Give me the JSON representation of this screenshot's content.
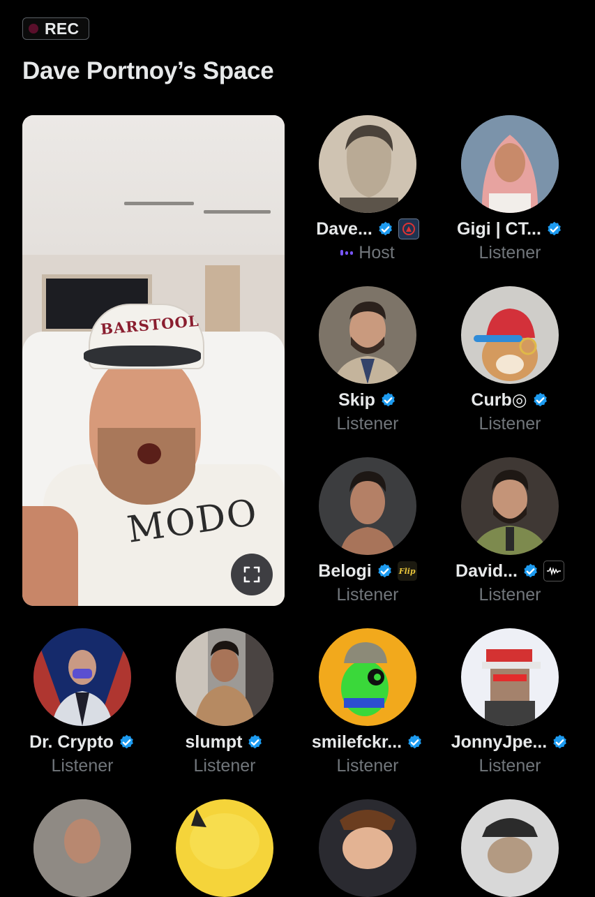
{
  "recording": {
    "label": "REC"
  },
  "space": {
    "title": "Dave Portnoy’s Space"
  },
  "video": {
    "cap_text": "BARSTOOL",
    "shirt_text": "MODO"
  },
  "participants": [
    {
      "name": "Dave...",
      "role": "Host",
      "verified": true,
      "affiliate": "barstool-badge"
    },
    {
      "name": "Gigi | CT...",
      "role": "Listener",
      "verified": true
    },
    {
      "name": "Skip",
      "role": "Listener",
      "verified": true
    },
    {
      "name": "Curb◎",
      "role": "Listener",
      "verified": true
    },
    {
      "name": "Belogi",
      "role": "Listener",
      "verified": true,
      "affiliate": "Flip"
    },
    {
      "name": "David...",
      "role": "Listener",
      "verified": true,
      "affiliate": "waveform-badge"
    },
    {
      "name": "Dr. Crypto",
      "role": "Listener",
      "verified": true
    },
    {
      "name": "slumpt",
      "role": "Listener",
      "verified": true
    },
    {
      "name": "smilefckr...",
      "role": "Listener",
      "verified": true
    },
    {
      "name": "JonnyJpe...",
      "role": "Listener",
      "verified": true
    }
  ],
  "colors": {
    "background": "#000000",
    "text_primary": "#e7e9ea",
    "text_secondary": "#71767b",
    "verified_blue": "#1d9bf0",
    "host_accent": "#7856ff",
    "rec_dot": "#5a0f2b"
  },
  "icons": [
    "verified-badge-icon",
    "fullscreen-icon",
    "host-speaking-icon",
    "rec-dot-icon"
  ]
}
